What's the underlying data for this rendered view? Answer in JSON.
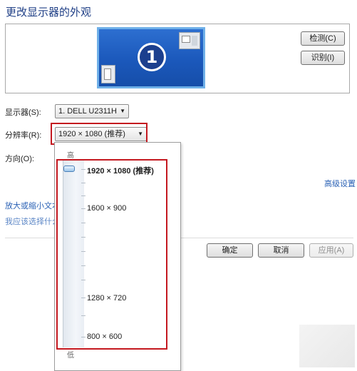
{
  "window": {
    "title": "更改显示器的外观"
  },
  "preview": {
    "monitor_number": "1",
    "detect_button": "检测(C)",
    "identify_button": "识别(I)"
  },
  "form": {
    "display_label": "显示器(S):",
    "display_value": "1. DELL U2311H",
    "resolution_label": "分辨率(R):",
    "resolution_value": "1920 × 1080 (推荐)",
    "orientation_label": "方向(O):"
  },
  "resolution_popup": {
    "high_label": "高",
    "low_label": "低",
    "options": [
      {
        "label": "1920 × 1080 (推荐)",
        "selected": true
      },
      {
        "label": "1600 × 900",
        "selected": false
      },
      {
        "label": "1280 × 720",
        "selected": false
      },
      {
        "label": "800 × 600",
        "selected": false
      }
    ],
    "slider_fraction": 1.0
  },
  "links": {
    "advanced_settings": "高级设置",
    "text_size": "放大或缩小文本",
    "which_settings": "我应该选择什么"
  },
  "actions": {
    "ok": "确定",
    "cancel": "取消",
    "apply": "应用(A)"
  },
  "colors": {
    "title_blue": "#1f3f86",
    "link_blue": "#2a61b5",
    "highlight_red": "#c4181f",
    "monitor_blue": "#1b58bb"
  }
}
